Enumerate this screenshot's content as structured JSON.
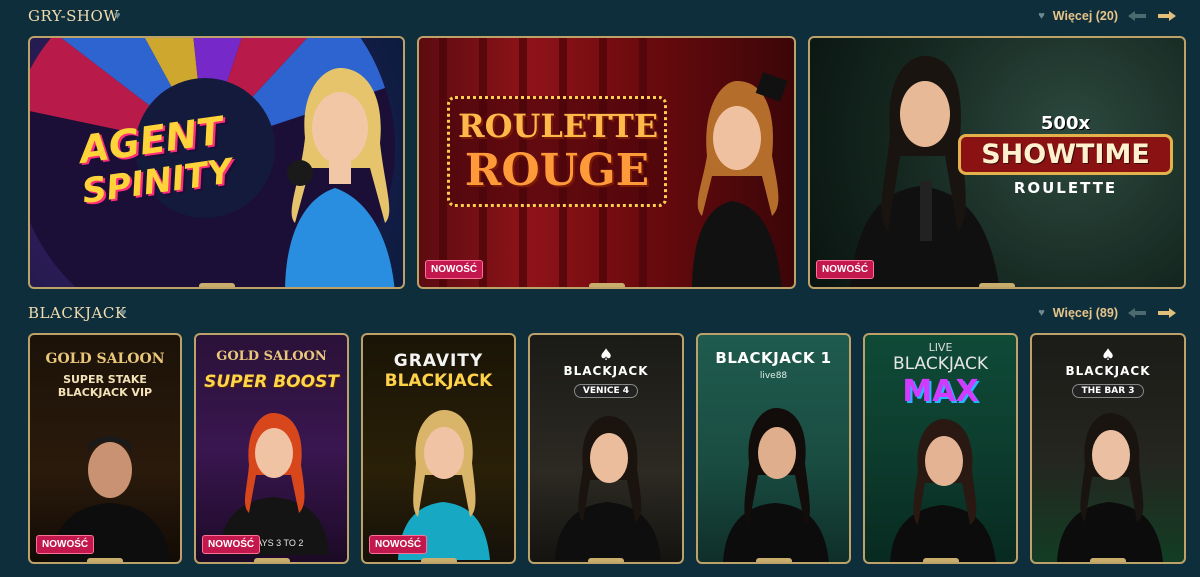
{
  "sections": {
    "gameshow": {
      "title": "GRY-SHOW",
      "more_label": "Więcej (20)"
    },
    "blackjack": {
      "title": "BLACKJACK",
      "more_label": "Więcej (89)"
    }
  },
  "badge_label": "NOWOŚĆ",
  "gameshow_games": [
    {
      "logo_line1": "AGENT",
      "logo_line2": "SPINITY",
      "badge": true
    },
    {
      "logo_line1": "ROULETTE",
      "logo_line2": "ROUGE",
      "badge": true
    },
    {
      "logo_top": "500x",
      "logo_line1": "SHOWTIME",
      "logo_line2": "ROULETTE",
      "badge": true
    }
  ],
  "blackjack_games": [
    {
      "line1": "GOLD SALOON",
      "line2": "SUPER STAKE",
      "line3": "BLACKJACK VIP",
      "badge": true
    },
    {
      "line1": "GOLD SALOON",
      "line2": "SUPER BOOST",
      "footer": "CK PAYS 3 TO 2",
      "badge": true
    },
    {
      "line1": "GRAVITY",
      "line2": "BLACKJACK",
      "badge": true
    },
    {
      "line1": "BLACKJACK",
      "line2": "VENICE 4",
      "badge": false
    },
    {
      "line1": "BLACKJACK 1",
      "line2": "live88",
      "badge": false
    },
    {
      "line1": "LIVE",
      "line2": "BLACKJACK",
      "line3": "MAX",
      "badge": false
    },
    {
      "line1": "BLACKJACK",
      "line2": "THE BAR 3",
      "badge": false
    }
  ],
  "colors": {
    "background": "#0f2e3c",
    "gold": "#e7c58a",
    "badge": "#c2184e"
  }
}
